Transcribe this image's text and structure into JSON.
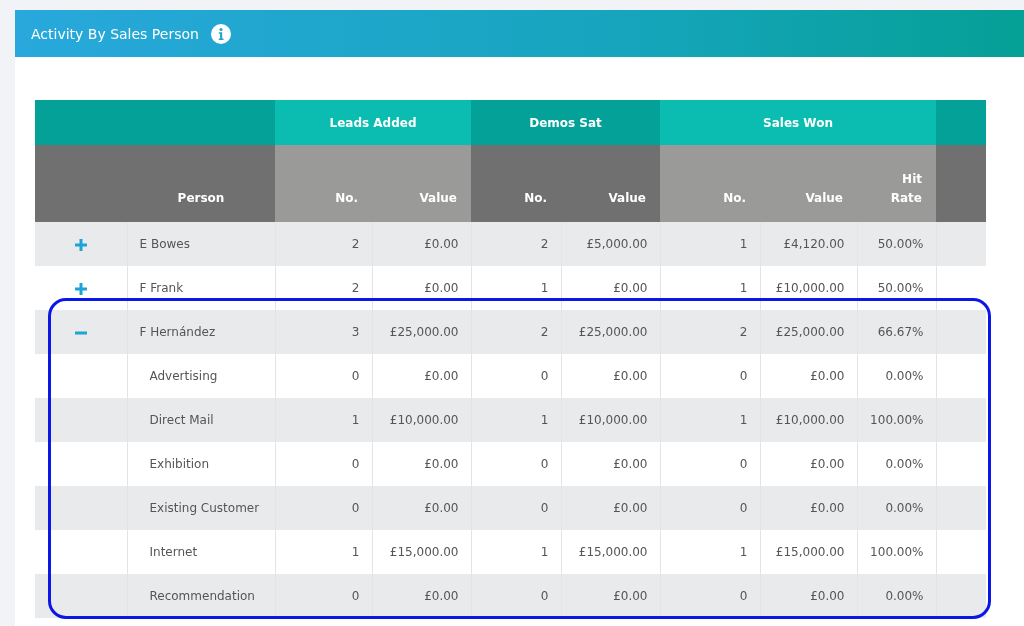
{
  "panel": {
    "title": "Activity By Sales Person"
  },
  "table": {
    "groups": [
      {
        "label": "Leads Added"
      },
      {
        "label": "Demos Sat"
      },
      {
        "label": "Sales Won"
      }
    ],
    "person_header": "Person",
    "columns": [
      "No.",
      "Value",
      "No.",
      "Value",
      "No.",
      "Value",
      "Hit Rate"
    ],
    "rows": [
      {
        "name": "E Bowes",
        "expanded": false,
        "cells": [
          "2",
          "£0.00",
          "2",
          "£5,000.00",
          "1",
          "£4,120.00",
          "50.00%"
        ]
      },
      {
        "name": "F Frank",
        "expanded": false,
        "cells": [
          "2",
          "£0.00",
          "1",
          "£0.00",
          "1",
          "£10,000.00",
          "50.00%"
        ]
      },
      {
        "name": "F Hernández",
        "expanded": true,
        "cells": [
          "3",
          "£25,000.00",
          "2",
          "£25,000.00",
          "2",
          "£25,000.00",
          "66.67%"
        ],
        "children": [
          {
            "name": "Advertising",
            "cells": [
              "0",
              "£0.00",
              "0",
              "£0.00",
              "0",
              "£0.00",
              "0.00%"
            ]
          },
          {
            "name": "Direct Mail",
            "cells": [
              "1",
              "£10,000.00",
              "1",
              "£10,000.00",
              "1",
              "£10,000.00",
              "100.00%"
            ]
          },
          {
            "name": "Exhibition",
            "cells": [
              "0",
              "£0.00",
              "0",
              "£0.00",
              "0",
              "£0.00",
              "0.00%"
            ]
          },
          {
            "name": "Existing Customer",
            "cells": [
              "0",
              "£0.00",
              "0",
              "£0.00",
              "0",
              "£0.00",
              "0.00%"
            ]
          },
          {
            "name": "Internet",
            "cells": [
              "1",
              "£15,000.00",
              "1",
              "£15,000.00",
              "1",
              "£15,000.00",
              "100.00%"
            ]
          },
          {
            "name": "Recommendation",
            "cells": [
              "0",
              "£0.00",
              "0",
              "£0.00",
              "0",
              "£0.00",
              "0.00%"
            ]
          }
        ]
      }
    ]
  }
}
